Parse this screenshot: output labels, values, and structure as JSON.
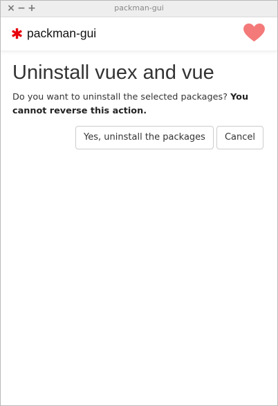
{
  "window": {
    "title": "packman-gui",
    "controls": {
      "close": "×",
      "minimize": "−",
      "maximize": "+"
    }
  },
  "navbar": {
    "brand_name": "packman-gui",
    "brand_icon": "asterisk-icon",
    "brand_icon_color": "#e8000b",
    "heart_icon": "heart-icon",
    "heart_color": "#f47a7a"
  },
  "main": {
    "title": "Uninstall vuex and vue",
    "message_prefix": "Do you want to uninstall the selected packages?",
    "message_warning": "You cannot reverse this action.",
    "confirm_label": "Yes, uninstall the packages",
    "cancel_label": "Cancel"
  }
}
